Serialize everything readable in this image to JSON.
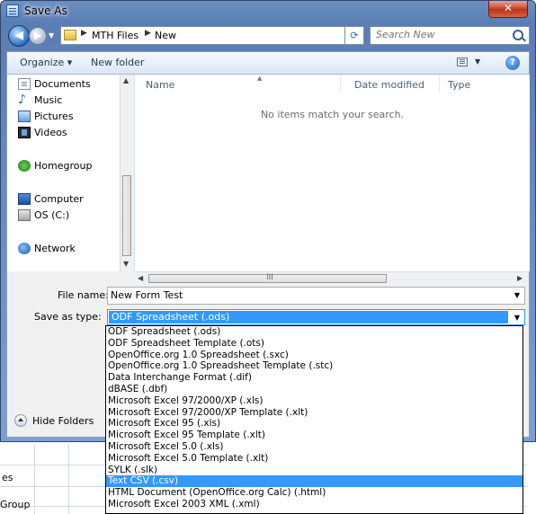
{
  "window": {
    "title": "Save As",
    "close_glyph": "✕"
  },
  "address": {
    "breadcrumbs": [
      "MTH Files",
      "New"
    ],
    "refresh_glyph": "⟳"
  },
  "search": {
    "placeholder": "Search New"
  },
  "toolbar": {
    "organize_label": "Organize ▾",
    "new_folder_label": "New folder",
    "help_glyph": "?"
  },
  "nav_pane": {
    "items": [
      {
        "label": "Documents",
        "icon": "documents-icon"
      },
      {
        "label": "Music",
        "icon": "music-icon"
      },
      {
        "label": "Pictures",
        "icon": "pictures-icon"
      },
      {
        "label": "Videos",
        "icon": "videos-icon"
      },
      {
        "label": "Homegroup",
        "icon": "homegroup-icon"
      },
      {
        "label": "Computer",
        "icon": "computer-icon"
      },
      {
        "label": "OS (C:)",
        "icon": "drive-icon"
      },
      {
        "label": "Network",
        "icon": "network-icon"
      }
    ]
  },
  "file_list": {
    "columns": [
      "Name",
      "Date modified",
      "Type"
    ],
    "empty_message": "No items match your search."
  },
  "form": {
    "file_name_label": "File name:",
    "file_name_value": "New Form Test",
    "save_type_label": "Save as type:",
    "save_type_value": "ODF Spreadsheet (.ods)"
  },
  "type_options": [
    "ODF Spreadsheet (.ods)",
    "ODF Spreadsheet Template (.ots)",
    "OpenOffice.org 1.0 Spreadsheet (.sxc)",
    "OpenOffice.org 1.0 Spreadsheet Template (.stc)",
    "Data Interchange Format (.dif)",
    "dBASE (.dbf)",
    "Microsoft Excel 97/2000/XP (.xls)",
    "Microsoft Excel 97/2000/XP Template (.xlt)",
    "Microsoft Excel 95 (.xls)",
    "Microsoft Excel 95 Template (.xlt)",
    "Microsoft Excel 5.0 (.xls)",
    "Microsoft Excel 5.0 Template (.xlt)",
    "SYLK (.slk)",
    "Text CSV (.csv)",
    "HTML Document (OpenOffice.org Calc) (.html)",
    "Microsoft Excel 2003 XML (.xml)"
  ],
  "highlighted_option": "Text CSV (.csv)",
  "hide_folders_label": "Hide Folders",
  "background_sheet": {
    "cell_a": "es",
    "cell_b": "Group"
  },
  "colors": {
    "selection": "#3399ff",
    "title_bar": "#6d8fc1"
  }
}
